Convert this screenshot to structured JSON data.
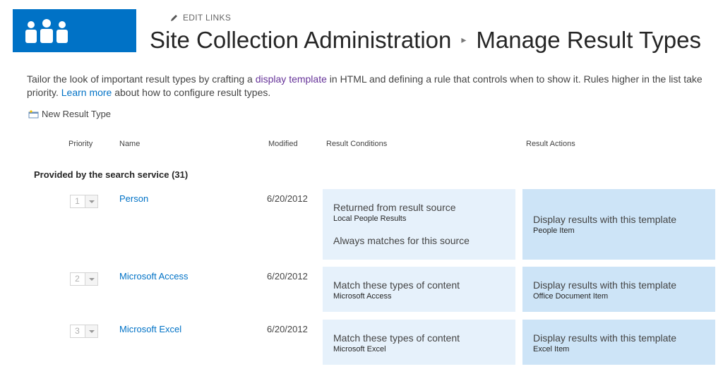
{
  "header": {
    "edit_links": "EDIT LINKS",
    "breadcrumb_parent": "Site Collection Administration",
    "page_title": "Manage Result Types"
  },
  "description": {
    "part1": "Tailor the look of important result types by crafting a ",
    "link1": "display template",
    "part2": " in HTML and defining a rule that controls when to show it. Rules higher in the list take priority. ",
    "link2": "Learn more",
    "part3": " about how to configure result types."
  },
  "toolbar": {
    "new_result_type": "New Result Type"
  },
  "columns": {
    "priority": "Priority",
    "name": "Name",
    "modified": "Modified",
    "conditions": "Result Conditions",
    "actions": "Result Actions"
  },
  "group": {
    "label": "Provided by the search service (31)"
  },
  "rows": [
    {
      "priority": "1",
      "name": "Person",
      "modified": "6/20/2012",
      "condition_title": "Returned from result source",
      "condition_detail": "Local People Results",
      "condition_extra": "Always matches for this source",
      "action_title": "Display results with this template",
      "action_detail": "People Item"
    },
    {
      "priority": "2",
      "name": "Microsoft Access",
      "modified": "6/20/2012",
      "condition_title": "Match these types of content",
      "condition_detail": "Microsoft Access",
      "action_title": "Display results with this template",
      "action_detail": "Office Document Item"
    },
    {
      "priority": "3",
      "name": "Microsoft Excel",
      "modified": "6/20/2012",
      "condition_title": "Match these types of content",
      "condition_detail": "Microsoft Excel",
      "action_title": "Display results with this template",
      "action_detail": "Excel Item"
    }
  ],
  "colors": {
    "brand": "#0072c6",
    "condition_bg": "#e6f1fb",
    "action_bg": "#cde4f7"
  },
  "icons": {
    "logo": "people-logo-icon",
    "edit": "pencil-icon",
    "new": "new-item-icon",
    "separator": "chevron-right-icon",
    "dropdown": "chevron-down-icon"
  }
}
